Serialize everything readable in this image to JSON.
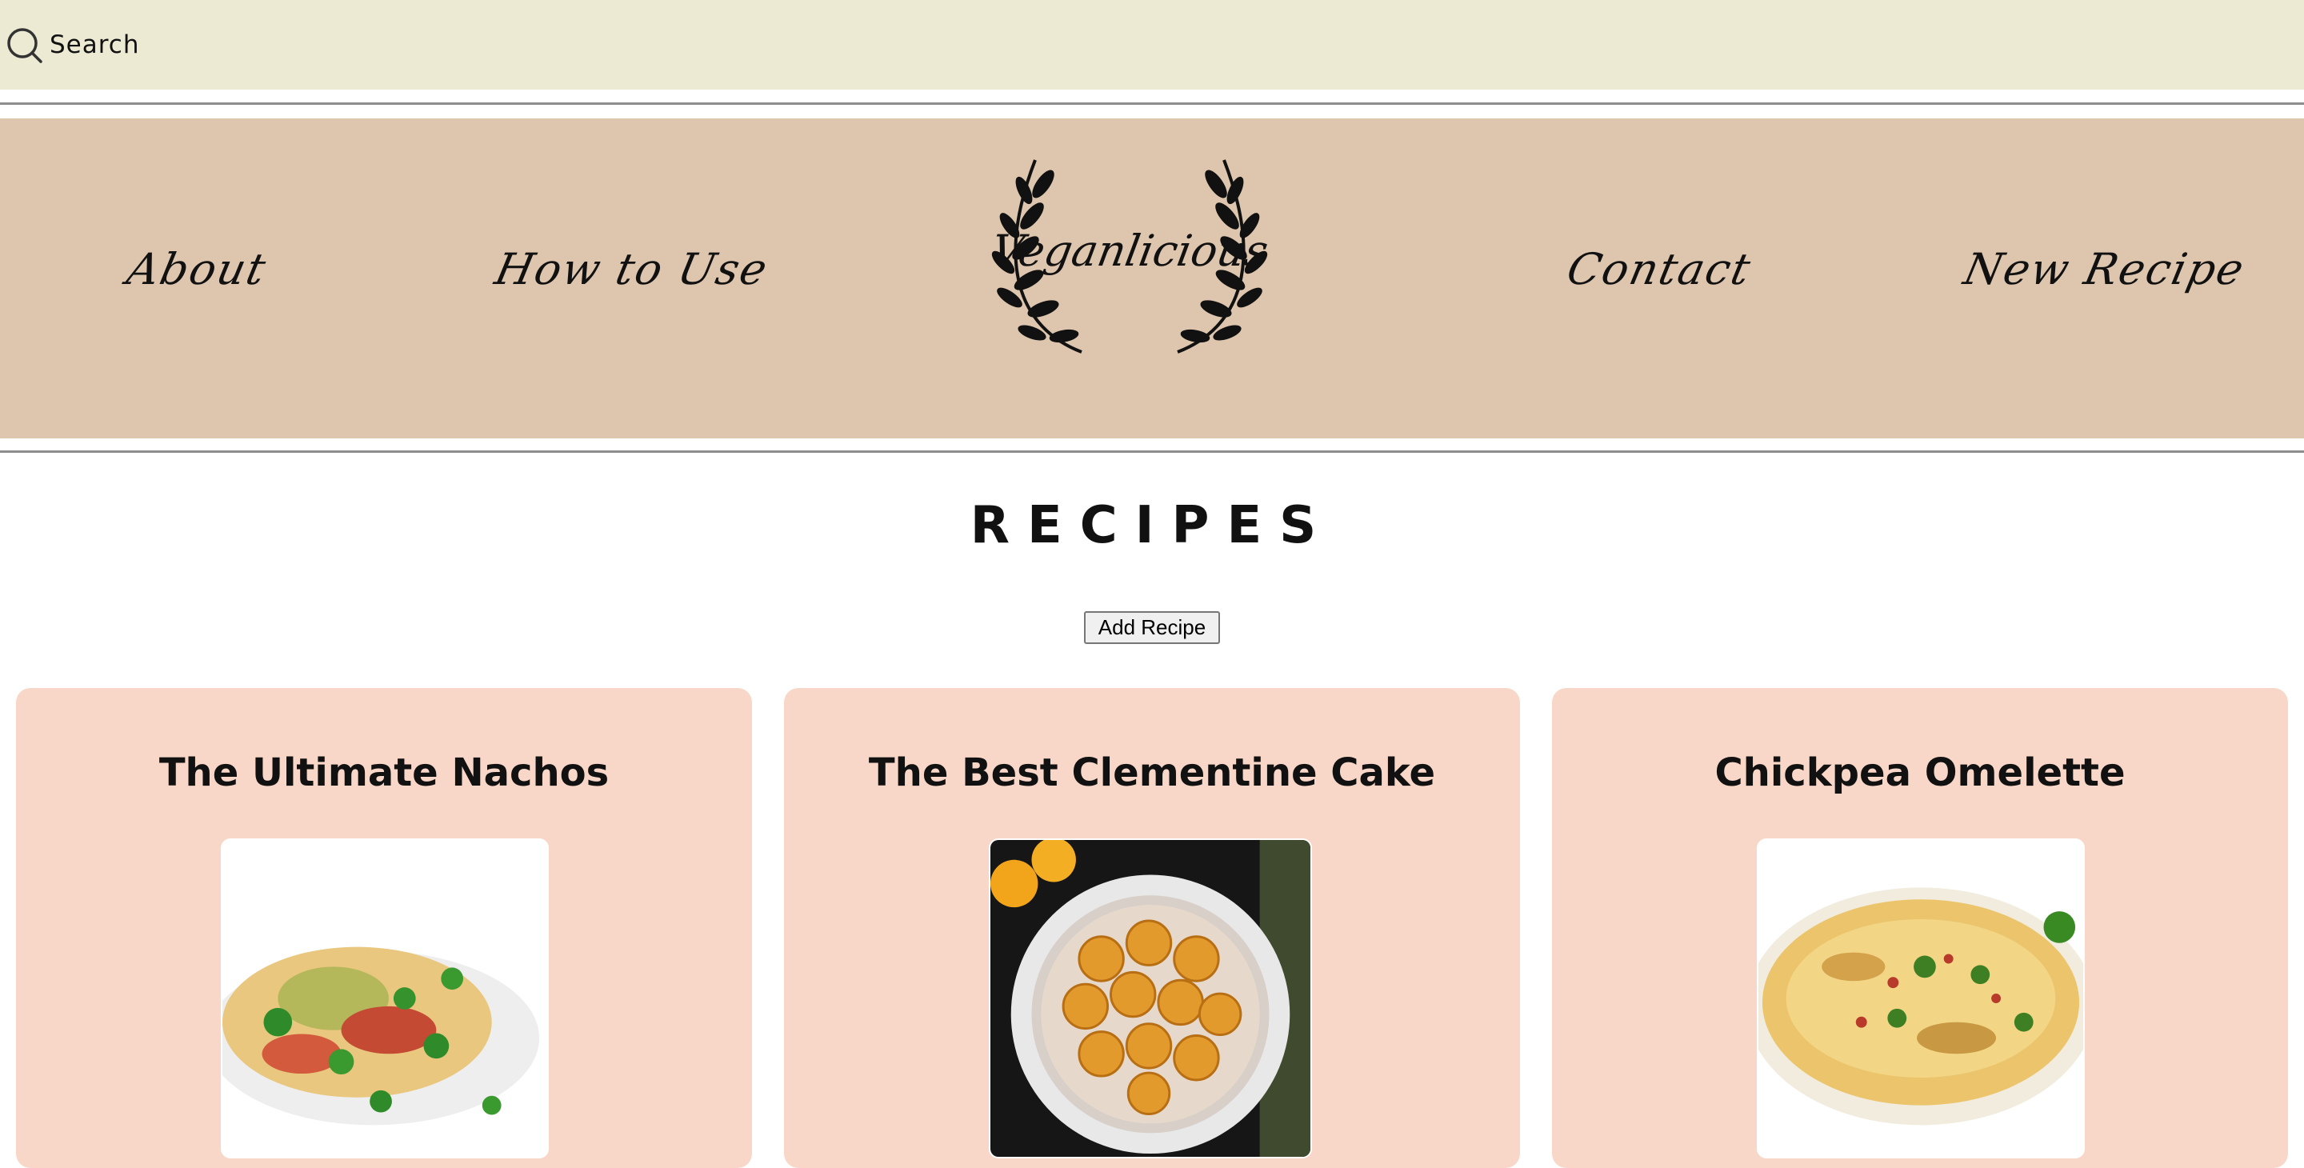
{
  "search": {
    "label": "Search"
  },
  "nav": {
    "about": "About",
    "how_to_use": "How to Use",
    "contact": "Contact",
    "new_recipe": "New Recipe"
  },
  "logo": {
    "text": "Veganlicious"
  },
  "recipes": {
    "title": "RECIPES",
    "add_button": "Add Recipe",
    "cards": [
      {
        "title": "The Ultimate Nachos"
      },
      {
        "title": "The Best Clementine Cake"
      },
      {
        "title": "Chickpea Omelette"
      }
    ]
  },
  "colors": {
    "search_bar": "#ecead3",
    "header": "#ddc5ae",
    "card": "#f8d6c8"
  }
}
